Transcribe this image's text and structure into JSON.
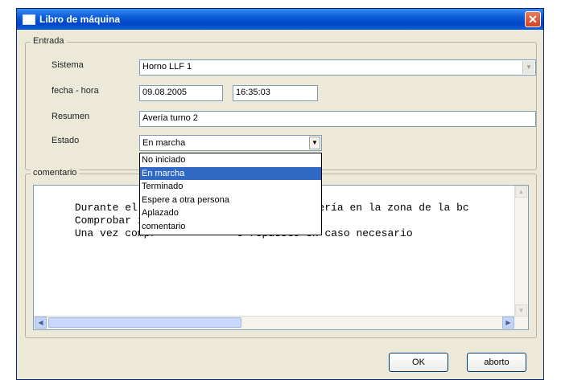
{
  "window": {
    "title": "Libro de máquina",
    "close_glyph": "✕"
  },
  "entrada": {
    "legend": "Entrada",
    "sistema": {
      "label": "Sistema",
      "value": "Horno LLF 1"
    },
    "fecha_hora": {
      "label": "fecha - hora",
      "date": "09.08.2005",
      "time": "16:35:03"
    },
    "resumen": {
      "label": "Resumen",
      "value": "Avería turno 2"
    },
    "estado": {
      "label": "Estado",
      "value": "En marcha",
      "options": [
        "No iniciado",
        "En marcha",
        "Terminado",
        "Espere a otra persona",
        "Aplazado",
        "comentario"
      ],
      "selected_index": 1
    }
  },
  "comentario": {
    "legend": "comentario",
    "lines": [
      {
        "part1": "Durante el tu",
        "part2": "a avería en la zona de la bc"
      },
      {
        "part1": "Comprobar inm",
        "part2": ""
      },
      {
        "part1": "Una vez compr",
        "part2": "o repuesto en caso necesario"
      }
    ]
  },
  "buttons": {
    "ok": "OK",
    "abort": "aborto"
  },
  "icons": {
    "combo_arrow": "▼",
    "scroll_up": "▲",
    "scroll_down": "▼",
    "scroll_left": "◀",
    "scroll_right": "▶"
  }
}
